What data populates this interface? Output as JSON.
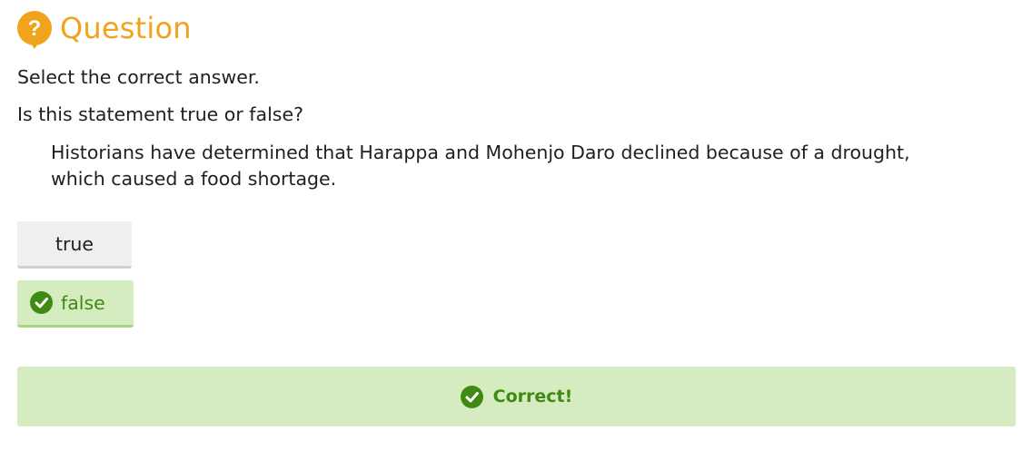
{
  "header": {
    "title": "Question",
    "icon": "question-bubble-icon",
    "icon_color": "#f0a41c"
  },
  "instruction": "Select the correct answer.",
  "prompt": "Is this statement true or false?",
  "statement": "Historians have determined that Harappa and Mohenjo Daro declined because of a drought, which caused a food shortage.",
  "choices": [
    {
      "label": "true",
      "selected": false
    },
    {
      "label": "false",
      "selected": true,
      "icon": "checkmark-circle-icon"
    }
  ],
  "feedback": {
    "text": "Correct!",
    "icon": "checkmark-circle-icon",
    "color": "#3f8a12",
    "background": "#d5ecc0"
  }
}
